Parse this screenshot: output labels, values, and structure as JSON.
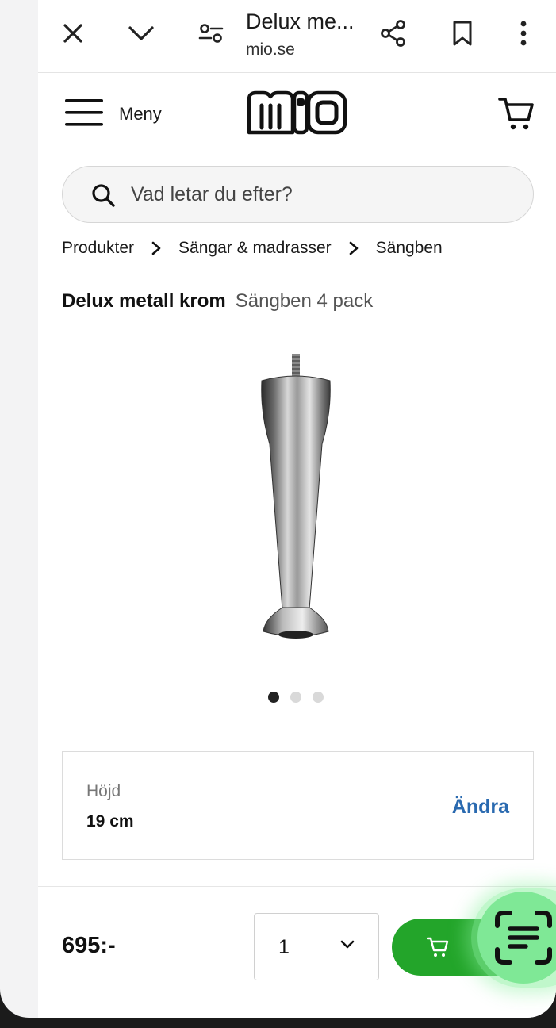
{
  "browser": {
    "title": "Delux me...",
    "url": "mio.se",
    "icons": [
      "close-icon",
      "chevron-down-icon",
      "tune-icon",
      "share-icon",
      "bookmark-icon",
      "more-vert-icon"
    ]
  },
  "header": {
    "menu_label": "Meny",
    "logo": "MiO",
    "icons": [
      "hamburger-icon",
      "cart-icon"
    ]
  },
  "search": {
    "placeholder": "Vad letar du efter?"
  },
  "breadcrumb": [
    "Produkter",
    "Sängar & madrasser",
    "Sängben"
  ],
  "product": {
    "name": "Delux metall krom",
    "subtitle": "Sängben 4 pack",
    "image_count": 3,
    "active_image": 1
  },
  "option": {
    "label": "Höjd",
    "value": "19 cm",
    "change_label": "Ändra"
  },
  "purchase": {
    "price": "695:-",
    "quantity": "1",
    "accent_color": "#23a52a"
  },
  "colors": {
    "link": "#2a6ab0",
    "lens_glow": "#7fe896"
  }
}
